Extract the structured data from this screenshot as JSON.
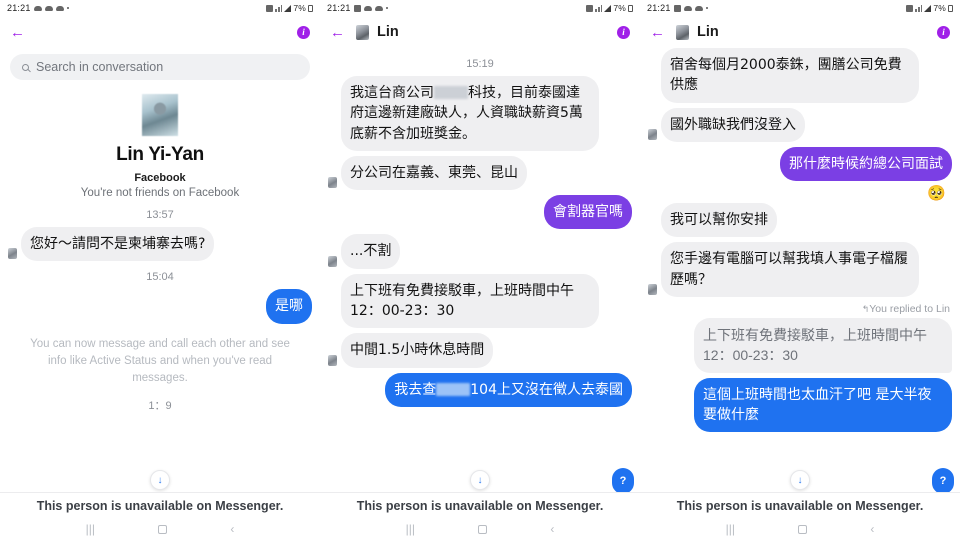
{
  "meta": {
    "colors": {
      "accent_purple": "#a020e8",
      "bubble_purple": "#7b3fe4",
      "bubble_blue": "#1f72f0",
      "bubble_in": "#efeff1"
    }
  },
  "status_bar": {
    "time": "21:21",
    "battery": "7%"
  },
  "panels": [
    {
      "id": "panel-search",
      "appbar": {
        "title": "",
        "has_avatar": false,
        "info_label": "i",
        "back_label": "←"
      },
      "search": {
        "placeholder": "Search in conversation"
      },
      "profile": {
        "name": "Lin Yi-Yan",
        "platform": "Facebook",
        "relation": "You're not friends on Facebook"
      },
      "messages": [
        {
          "kind": "timestamp",
          "text": "13:57"
        },
        {
          "kind": "in",
          "text": "您好〜請問不是柬埔寨去嗎?"
        },
        {
          "kind": "timestamp",
          "text": "15:04"
        },
        {
          "kind": "out-blue",
          "text": "是哪"
        },
        {
          "kind": "sysnote",
          "text": "You can now message and call each other and see info like Active Status and when you've read messages."
        },
        {
          "kind": "timestamp",
          "text": "1：9"
        }
      ],
      "scroll_fab": "↓",
      "footer": "This person is unavailable on Messenger."
    },
    {
      "id": "panel-mid",
      "appbar": {
        "title": "Lin",
        "has_avatar": true,
        "info_label": "i",
        "back_label": "←"
      },
      "messages": [
        {
          "kind": "timestamp",
          "text": "15:19"
        },
        {
          "kind": "in",
          "text_before": "我這台商公司",
          "redacted": true,
          "text_after": "科技，目前泰國達府這邊新建廠缺人，人資職缺薪資5萬底薪不含加班獎金。"
        },
        {
          "kind": "in",
          "text": "分公司在嘉義、東莞、昆山"
        },
        {
          "kind": "out-purple",
          "text": "會割器官嗎"
        },
        {
          "kind": "in",
          "text": "...不割"
        },
        {
          "kind": "in",
          "text": "上下班有免費接駁車，上班時間中午12：00-23：30"
        },
        {
          "kind": "in",
          "text": "中間1.5小時休息時間"
        },
        {
          "kind": "out-blue",
          "text_before": "我去查",
          "redacted": true,
          "text_after": "104上又沒在徵人去泰國"
        }
      ],
      "scroll_fab": "↓",
      "q_badge": "?",
      "footer": "This person is unavailable on Messenger."
    },
    {
      "id": "panel-right",
      "appbar": {
        "title": "Lin",
        "has_avatar": true,
        "info_label": "i",
        "back_label": "←"
      },
      "messages": [
        {
          "kind": "in",
          "text": "宿舍每個月2000泰銖，團膳公司免費供應"
        },
        {
          "kind": "in",
          "text": "國外職缺我們沒登入"
        },
        {
          "kind": "out-purple",
          "text": "那什麼時候約總公司面試"
        },
        {
          "kind": "reaction",
          "text": "🥺"
        },
        {
          "kind": "in",
          "text": "我可以幫你安排"
        },
        {
          "kind": "in",
          "text": "您手邊有電腦可以幫我填人事電子檔履歷嗎？"
        },
        {
          "kind": "reply-label",
          "text": "You replied to Lin"
        },
        {
          "kind": "reply-quote",
          "text": "上下班有免費接駁車，上班時間中午12：00-23：30"
        },
        {
          "kind": "out-blue",
          "text": "這個上班時間也太血汗了吧 是大半夜要做什麼"
        }
      ],
      "scroll_fab": "↓",
      "q_badge": "?",
      "footer": "This person is unavailable on Messenger."
    }
  ],
  "navbar": {
    "recents": "‖‖",
    "home": "",
    "back": "‹"
  }
}
